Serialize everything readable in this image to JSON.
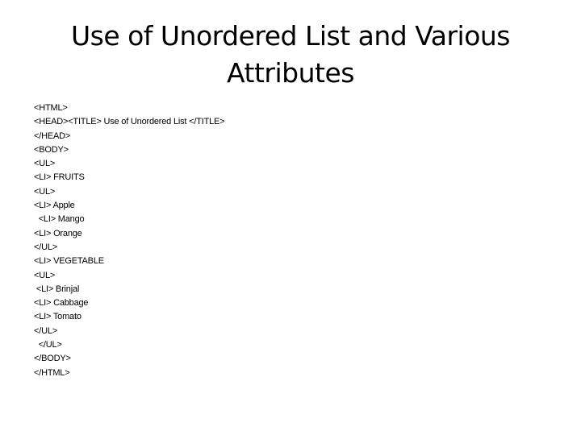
{
  "slide": {
    "title_line1": "Use of Unordered List and Various",
    "title_line2": "Attributes",
    "code_lines": [
      "<HTML>",
      "<HEAD><TITLE> Use of Unordered List </TITLE>",
      "</HEAD>",
      "<BODY>",
      "<UL>",
      "<LI> FRUITS",
      "<UL>",
      "<LI> Apple",
      "  <LI> Mango",
      "<LI> Orange",
      "</UL>",
      "<LI> VEGETABLE",
      "<UL>",
      " <LI> Brinjal",
      "<LI> Cabbage",
      "<LI> Tomato",
      "</UL>",
      "  </UL>",
      "</BODY>",
      "</HTML>"
    ]
  }
}
